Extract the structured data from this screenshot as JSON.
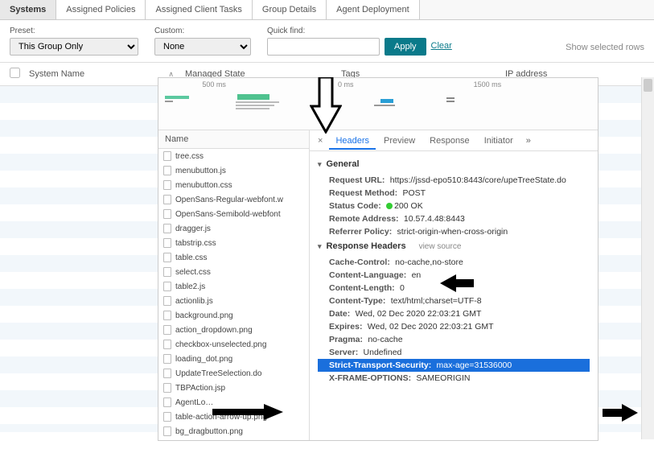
{
  "tabs": {
    "systems": "Systems",
    "assigned_policies": "Assigned Policies",
    "assigned_client_tasks": "Assigned Client Tasks",
    "group_details": "Group Details",
    "agent_deployment": "Agent Deployment"
  },
  "filters": {
    "preset_label": "Preset:",
    "preset_value": "This Group Only",
    "custom_label": "Custom:",
    "custom_value": "None",
    "quick_find_label": "Quick find:",
    "quick_find_value": "",
    "apply": "Apply",
    "clear": "Clear",
    "selected_rows": "Show selected rows"
  },
  "columns": {
    "system_name": "System Name",
    "managed_state": "Managed State",
    "tags": "Tags",
    "ip_address": "IP address"
  },
  "timeline": {
    "t1": "500 ms",
    "t2": "0 ms",
    "t3": "1500 ms"
  },
  "devtools": {
    "name_label": "Name",
    "files": [
      "tree.css",
      "menubutton.js",
      "menubutton.css",
      "OpenSans-Regular-webfont.w",
      "OpenSans-Semibold-webfont",
      "dragger.js",
      "tabstrip.css",
      "table.css",
      "select.css",
      "table2.js",
      "actionlib.js",
      "background.png",
      "action_dropdown.png",
      "checkbox-unselected.png",
      "loading_dot.png",
      "UpdateTreeSelection.do",
      "TBPAction.jsp",
      "AgentLo…",
      "table-action-arrow-up.png",
      "bg_dragbutton.png"
    ],
    "detail_tabs": {
      "headers": "Headers",
      "preview": "Preview",
      "response": "Response",
      "initiator": "Initiator",
      "close": "×",
      "more": "»"
    },
    "general": {
      "title": "General",
      "request_url_k": "Request URL:",
      "request_url_v": "https://jssd-epo510:8443/core/upeTreeState.do",
      "request_method_k": "Request Method:",
      "request_method_v": "POST",
      "status_code_k": "Status Code:",
      "status_code_v": "200 OK",
      "remote_addr_k": "Remote Address:",
      "remote_addr_v": "10.57.4.48:8443",
      "referrer_k": "Referrer Policy:",
      "referrer_v": "strict-origin-when-cross-origin"
    },
    "response_headers": {
      "title": "Response Headers",
      "view_source": "view source",
      "items": [
        {
          "k": "Cache-Control:",
          "v": "no-cache,no-store"
        },
        {
          "k": "Content-Language:",
          "v": "en"
        },
        {
          "k": "Content-Length:",
          "v": "0"
        },
        {
          "k": "Content-Type:",
          "v": "text/html;charset=UTF-8"
        },
        {
          "k": "Date:",
          "v": "Wed, 02 Dec 2020 22:03:21 GMT"
        },
        {
          "k": "Expires:",
          "v": "Wed, 02 Dec 2020 22:03:21 GMT"
        },
        {
          "k": "Pragma:",
          "v": "no-cache"
        },
        {
          "k": "Server:",
          "v": "Undefined"
        },
        {
          "k": "Strict-Transport-Security:",
          "v": "max-age=31536000",
          "highlight": true
        },
        {
          "k": "X-FRAME-OPTIONS:",
          "v": "SAMEORIGIN"
        }
      ]
    }
  }
}
